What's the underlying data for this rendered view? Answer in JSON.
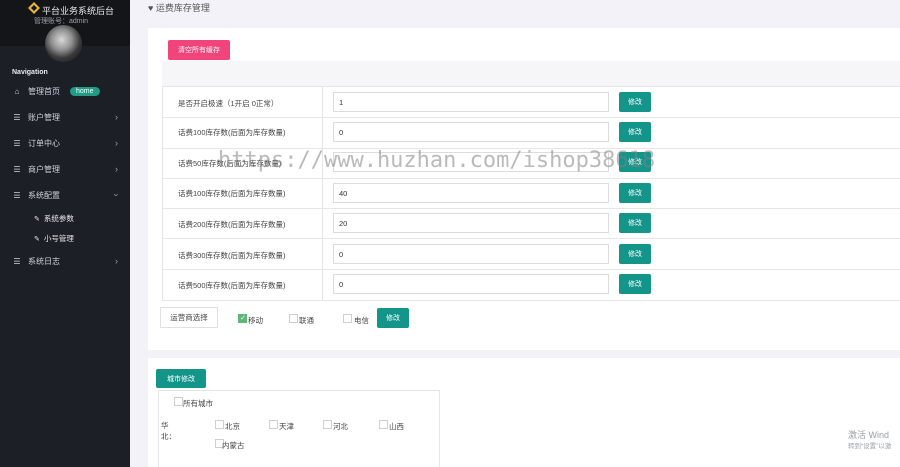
{
  "sidebar": {
    "brand": "平台业务系统后台",
    "admin_line": "管理账号：admin",
    "nav_title": "Navigation",
    "items": [
      {
        "label": "管理首页",
        "badge": "home"
      },
      {
        "label": "账户管理"
      },
      {
        "label": "订单中心"
      },
      {
        "label": "商户管理"
      },
      {
        "label": "系统配置"
      },
      {
        "label": "系统日志"
      }
    ],
    "sub_items": [
      {
        "label": "系统参数"
      },
      {
        "label": "小号管理"
      }
    ]
  },
  "header": {
    "title": "运费库存管理"
  },
  "main": {
    "top_button": "清空所有缓存",
    "rows": [
      {
        "label": "是否开启极速（1开启 0正常）",
        "value": "1",
        "button": "修改"
      },
      {
        "label": "话费100库存数(后面为库存数量)",
        "value": "0",
        "button": "修改"
      },
      {
        "label": "话费50库存数(后面为库存数量)",
        "value": "",
        "button": "修改"
      },
      {
        "label": "话费100库存数(后面为库存数量)",
        "value": "40",
        "button": "修改"
      },
      {
        "label": "话费200库存数(后面为库存数量)",
        "value": "20",
        "button": "修改"
      },
      {
        "label": "话费300库存数(后面为库存数量)",
        "value": "0",
        "button": "修改"
      },
      {
        "label": "话费500库存数(后面为库存数量)",
        "value": "0",
        "button": "修改"
      }
    ],
    "carrier": {
      "label": "运营商选择",
      "options": [
        {
          "label": "移动",
          "checked": true
        },
        {
          "label": "联通",
          "checked": false
        },
        {
          "label": "电信",
          "checked": false
        }
      ],
      "button": "修改"
    }
  },
  "area": {
    "button": "城市修改",
    "all_label": "所有城市",
    "region_label": "华北：",
    "cities": [
      "北京",
      "天津",
      "河北",
      "山西",
      "内蒙古"
    ]
  },
  "watermark": {
    "overlay": "https://www.huzhan.com/ishop38618",
    "win_line1": "激活 Wind",
    "win_line2": "转到“设置”以激"
  },
  "colors": {
    "sidebar_bg": "#1c1f26",
    "accent_pink": "#f0447a",
    "accent_teal": "#14958a",
    "check_green": "#5fb878",
    "badge_green": "#1e9c85"
  }
}
